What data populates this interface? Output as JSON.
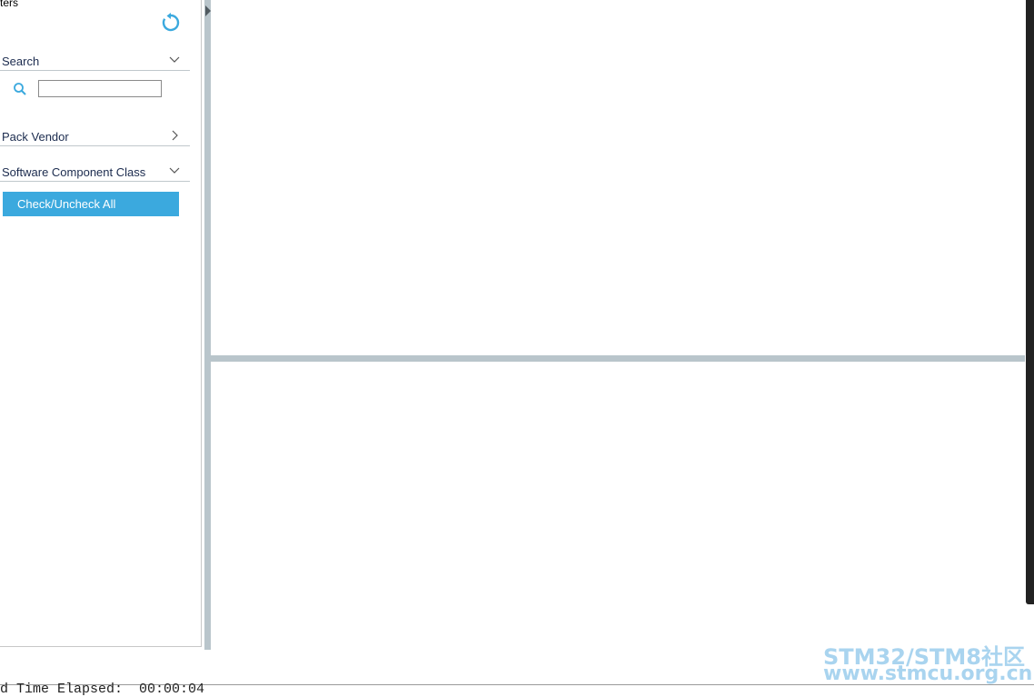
{
  "filter_panel": {
    "title": "ters",
    "sections": {
      "search": {
        "label": "Search",
        "expanded": true
      },
      "pack_vendor": {
        "label": "Pack Vendor",
        "expanded": false
      },
      "software_component_class": {
        "label": "Software Component Class",
        "expanded": true
      }
    },
    "search_input": {
      "value": "",
      "placeholder": ""
    },
    "check_uncheck_label": "Check/Uncheck All"
  },
  "status": {
    "text": "d Time Elapsed:  00:00:04"
  },
  "watermark": {
    "line1": "STM32/STM8社区",
    "line2": "www.stmcu.org.cn"
  },
  "colors": {
    "accent": "#3ba9de",
    "splitter": "#b9c5cb",
    "label_text": "#1b2b4e",
    "watermark": "#a9d4ef"
  },
  "icons": {
    "refresh": "refresh-icon",
    "search": "search-icon",
    "chevron_down": "chevron-down-icon",
    "chevron_right": "chevron-right-icon",
    "collapse": "collapse-arrow-icon"
  }
}
